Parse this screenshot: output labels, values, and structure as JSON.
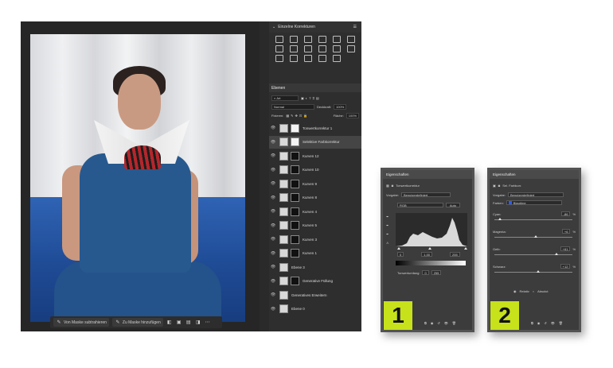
{
  "toolbar": {
    "subtract_label": "Von Maske subtrahieren",
    "add_label": "Zu Maske hinzufügen"
  },
  "adjustments": {
    "title": "Einzelne Korrekturen"
  },
  "layers": {
    "tab": "Ebenen",
    "search": "Art",
    "blend_mode": "Normal",
    "opacity_label": "Deckkraft:",
    "opacity_value": "100%",
    "lock_label": "Fixieren:",
    "fill_label": "Fläche:",
    "fill_value": "100%",
    "items": [
      {
        "name": "Tonwertkorrektur 1",
        "mask": "white",
        "selected": false
      },
      {
        "name": "Selektive Farbkorrektur",
        "mask": "white",
        "selected": true
      },
      {
        "name": "Kurven 12",
        "mask": "black",
        "selected": false
      },
      {
        "name": "Kurven 10",
        "mask": "black",
        "selected": false
      },
      {
        "name": "Kurven 9",
        "mask": "black",
        "selected": false
      },
      {
        "name": "Kurven 8",
        "mask": "black",
        "selected": false
      },
      {
        "name": "Kurven 4",
        "mask": "black",
        "selected": false
      },
      {
        "name": "Kurven 5",
        "mask": "black",
        "selected": false
      },
      {
        "name": "Kurven 3",
        "mask": "black",
        "selected": false
      },
      {
        "name": "Kurven 1",
        "mask": "black",
        "selected": false
      },
      {
        "name": "Ebene 3",
        "mask": "none",
        "selected": false
      },
      {
        "name": "Generative Füllung",
        "mask": "black",
        "selected": false
      },
      {
        "name": "Generatives Erweitern",
        "mask": "none",
        "selected": false
      },
      {
        "name": "Ebene 0",
        "mask": "none",
        "selected": false
      }
    ]
  },
  "props1": {
    "title": "Eigenschaften",
    "subtitle": "Tonwertkorrektur",
    "preset_label": "Vorgabe:",
    "preset_value": "Benutzerdefiniert",
    "channel_value": "RGB",
    "auto_label": "Auto",
    "input_low": "0",
    "input_mid": "1,00",
    "input_high": "255",
    "output_label": "Tonwertumfang:",
    "output_low": "0",
    "output_high": "255",
    "badge": "1"
  },
  "props2": {
    "title": "Eigenschaften",
    "subtitle": "Sel. Farbkorr.",
    "preset_label": "Vorgabe:",
    "preset_value": "Benutzerdefiniert",
    "colors_label": "Farben:",
    "colors_value": "Blautöne",
    "sliders": [
      {
        "label": "Cyan:",
        "value": "-86",
        "fraction": 0.07
      },
      {
        "label": "Magenta:",
        "value": "+6",
        "fraction": 0.53
      },
      {
        "label": "Gelb:",
        "value": "+61",
        "fraction": 0.8
      },
      {
        "label": "Schwarz:",
        "value": "+12",
        "fraction": 0.56
      }
    ],
    "unit": "%",
    "relative_label": "Relativ",
    "absolute_label": "Absolut",
    "badge": "2"
  }
}
